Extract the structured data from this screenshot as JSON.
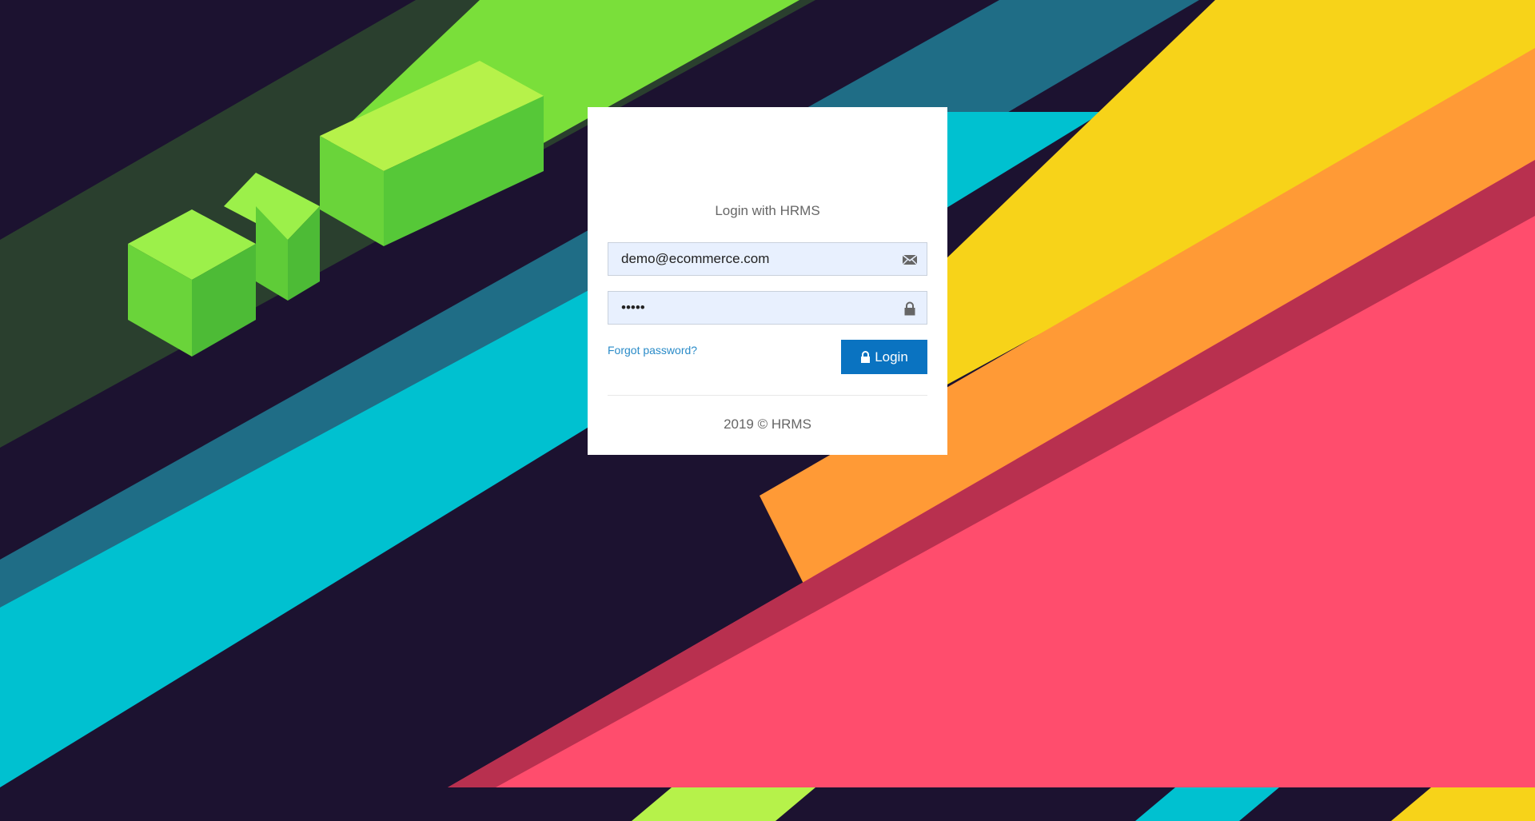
{
  "login": {
    "title": "Login with HRMS",
    "email_value": "demo@ecommerce.com",
    "password_value": "•••••",
    "forgot_label": "Forgot password?",
    "login_label": "Login",
    "footer": "2019 © HRMS"
  },
  "icons": {
    "email": "envelope-icon",
    "password": "padlock-icon",
    "login": "lock-icon"
  },
  "colors": {
    "button": "#0a73c1",
    "link": "#2a8bc8",
    "input_bg": "#e8f0fe"
  }
}
